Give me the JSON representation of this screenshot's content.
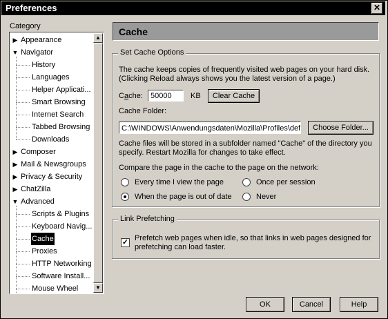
{
  "window": {
    "title": "Preferences",
    "close_glyph": "✕"
  },
  "category": {
    "label": "Category",
    "items": [
      {
        "label": "Appearance",
        "arrow": "▶"
      },
      {
        "label": "Navigator",
        "arrow": "▼"
      },
      {
        "label": "History"
      },
      {
        "label": "Languages"
      },
      {
        "label": "Helper Applicati..."
      },
      {
        "label": "Smart Browsing"
      },
      {
        "label": "Internet Search"
      },
      {
        "label": "Tabbed Browsing"
      },
      {
        "label": "Downloads"
      },
      {
        "label": "Composer",
        "arrow": "▶"
      },
      {
        "label": "Mail & Newsgroups",
        "arrow": "▶"
      },
      {
        "label": "Privacy & Security",
        "arrow": "▶"
      },
      {
        "label": "ChatZilla",
        "arrow": "▶"
      },
      {
        "label": "Advanced",
        "arrow": "▼"
      },
      {
        "label": "Scripts & Plugins"
      },
      {
        "label": "Keyboard Navig..."
      },
      {
        "label": "Cache",
        "selected": true
      },
      {
        "label": "Proxies"
      },
      {
        "label": "HTTP Networking"
      },
      {
        "label": "Software Install..."
      },
      {
        "label": "Mouse Wheel"
      }
    ]
  },
  "panel": {
    "title": "Cache",
    "set_cache": {
      "legend": "Set Cache Options",
      "desc1": "The cache keeps copies of frequently visited web pages on your hard disk.",
      "desc2": "(Clicking Reload always shows you the latest version of a page.)",
      "cache_label_pre": "C",
      "cache_label_ul": "a",
      "cache_label_post": "che:",
      "cache_value": "50000",
      "cache_unit": "KB",
      "clear_button": "Clear Cache",
      "folder_label": "Cache Folder:",
      "folder_value": "C:\\WINDOWS\\Anwendungsdaten\\Mozilla\\Profiles\\def",
      "choose_button": "Choose Folder...",
      "folder_note1": "Cache files will be stored in a subfolder named \"Cache\" of the directory you",
      "folder_note2": "specify. Restart Mozilla for changes to take effect.",
      "compare_label": "Compare the page in the cache to the page on the network:",
      "options": [
        {
          "label": "Every time I view the page",
          "checked": false
        },
        {
          "label": "Once per session",
          "checked": false
        },
        {
          "label": "When the page is out of date",
          "checked": true
        },
        {
          "label": "Never",
          "checked": false
        }
      ]
    },
    "prefetch": {
      "legend": "Link Prefetching",
      "line1": "Prefetch web pages when idle, so that links in web pages designed for",
      "line2": "prefetching can load faster.",
      "checked": true,
      "check_glyph": "✓"
    }
  },
  "footer": {
    "ok": "OK",
    "cancel": "Cancel",
    "help": "Help"
  }
}
